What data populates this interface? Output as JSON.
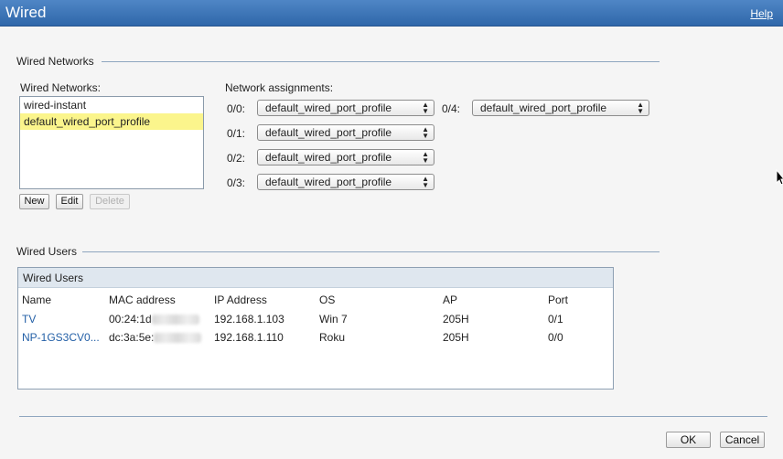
{
  "window": {
    "title": "Wired",
    "help": "Help"
  },
  "wired_networks": {
    "section_title": "Wired Networks",
    "list_label": "Wired Networks:",
    "items": [
      {
        "label": "wired-instant",
        "selected": false
      },
      {
        "label": "default_wired_port_profile",
        "selected": true
      }
    ],
    "buttons": {
      "new": "New",
      "edit": "Edit",
      "delete": "Delete"
    }
  },
  "network_assignments": {
    "label": "Network assignments:",
    "ports": [
      {
        "port": "0/0:",
        "value": "default_wired_port_profile"
      },
      {
        "port": "0/1:",
        "value": "default_wired_port_profile"
      },
      {
        "port": "0/2:",
        "value": "default_wired_port_profile"
      },
      {
        "port": "0/3:",
        "value": "default_wired_port_profile"
      },
      {
        "port": "0/4:",
        "value": "default_wired_port_profile"
      }
    ]
  },
  "wired_users": {
    "section_title": "Wired Users",
    "panel_title": "Wired Users",
    "columns": [
      "Name",
      "MAC address",
      "IP Address",
      "OS",
      "AP",
      "Port"
    ],
    "rows": [
      {
        "name": "TV",
        "mac": "00:24:1d",
        "ip": "192.168.1.103",
        "os": "Win 7",
        "ap": "205H",
        "port": "0/1"
      },
      {
        "name": "NP-1GS3CV0...",
        "mac": "dc:3a:5e:",
        "ip": "192.168.1.110",
        "os": "Roku",
        "ap": "205H",
        "port": "0/0"
      }
    ]
  },
  "footer": {
    "ok": "OK",
    "cancel": "Cancel"
  },
  "colors": {
    "titlebar": "#3a72b6",
    "selection": "#fbf58c",
    "link": "#2460a7"
  }
}
